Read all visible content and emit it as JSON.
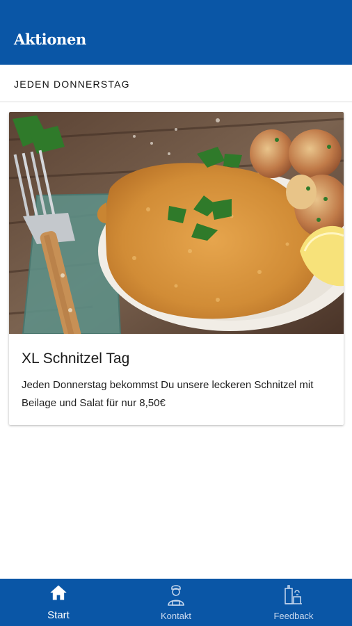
{
  "app_bar": {
    "title": "Aktionen"
  },
  "section": {
    "title": "JEDEN DONNERSTAG"
  },
  "promo_card": {
    "title": "XL Schnitzel Tag",
    "description": "Jeden Donnerstag bekommst Du unsere leckeren Schnitzel mit Beilage und Salat für nur 8,50€",
    "image_icon": "schnitzel-photo"
  },
  "bottom_nav": {
    "items": [
      {
        "label": "Start",
        "icon": "home-icon",
        "active": true
      },
      {
        "label": "Kontakt",
        "icon": "contact-person-icon",
        "active": false
      },
      {
        "label": "Feedback",
        "icon": "feedback-icon",
        "active": false
      }
    ]
  },
  "colors": {
    "primary": "#0a56a6",
    "text": "#111111",
    "background": "#ffffff"
  }
}
